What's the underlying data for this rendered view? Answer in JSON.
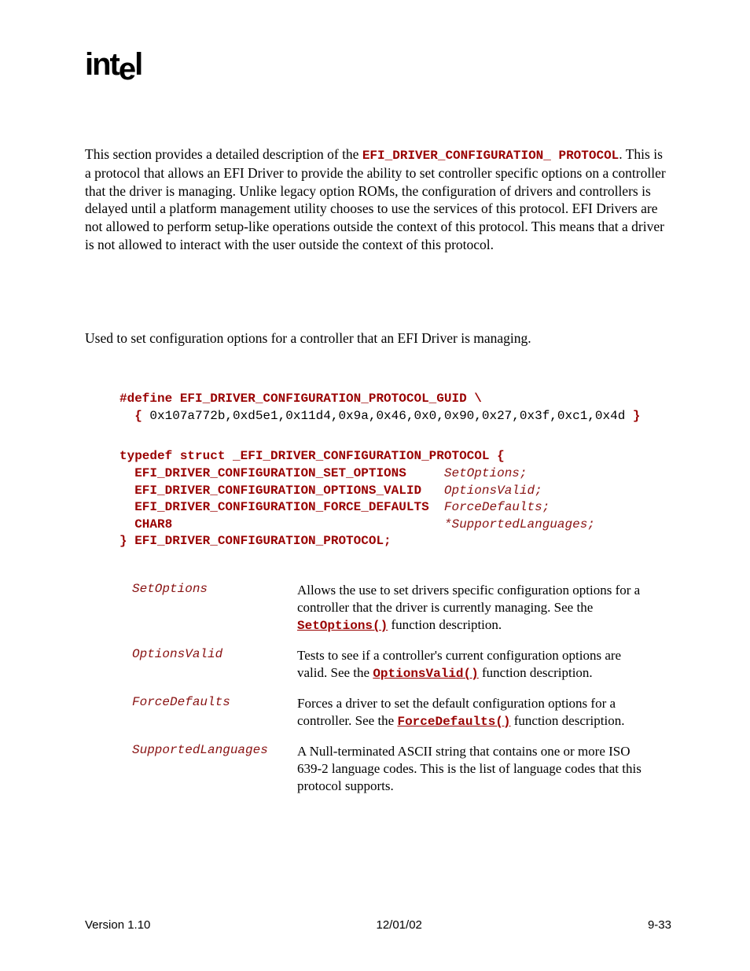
{
  "intro": {
    "pre1": "This section provides a detailed description of the ",
    "code1": "EFI_DRIVER_CONFIGURATION_ PROTOCOL",
    "post1": ".  This is a protocol that allows an EFI Driver to provide the ability to set controller specific options on a controller that the driver is managing.  Unlike legacy option ROMs, the configuration of drivers and controllers is delayed until a platform management utility chooses to use the services of this protocol.  EFI Drivers are not allowed to perform setup-like operations outside the context of this protocol.  This means that a driver is not allowed to interact with the user outside the context of this protocol."
  },
  "summary": "Used to set configuration options for a controller that an EFI Driver is managing.",
  "guid": {
    "line1": "#define EFI_DRIVER_CONFIGURATION_PROTOCOL_GUID \\",
    "brace_open": "  { ",
    "body": "0x107a772b,0xd5e1,0x11d4,0x9a,0x46,0x0,0x90,0x27,0x3f,0xc1,0x4d",
    "brace_close": " }"
  },
  "struct": {
    "open": "typedef struct _EFI_DRIVER_CONFIGURATION_PROTOCOL {",
    "f1_type": "  EFI_DRIVER_CONFIGURATION_SET_OPTIONS     ",
    "f1_name": "SetOptions;",
    "f2_type": "  EFI_DRIVER_CONFIGURATION_OPTIONS_VALID   ",
    "f2_name": "OptionsValid;",
    "f3_type": "  EFI_DRIVER_CONFIGURATION_FORCE_DEFAULTS  ",
    "f3_name": "ForceDefaults;",
    "f4_type": "  CHAR8                                    ",
    "f4_name": "*SupportedLanguages;",
    "close": "} EFI_DRIVER_CONFIGURATION_PROTOCOL;"
  },
  "params": {
    "p1_name": "SetOptions",
    "p1_pre": "Allows the use to set drivers specific configuration options for a controller that the driver is currently managing.  See the ",
    "p1_link": "SetOptions()",
    "p1_post": " function description.",
    "p2_name": "OptionsValid",
    "p2_pre": "Tests to see if a controller's current configuration options are valid.  See the ",
    "p2_link": "OptionsValid()",
    "p2_post": " function description.",
    "p3_name": "ForceDefaults",
    "p3_pre": "Forces a driver to set the default configuration options for a controller.  See the ",
    "p3_link": "ForceDefaults()",
    "p3_post": " function description.",
    "p4_name": "SupportedLanguages",
    "p4_desc": "A Null-terminated ASCII string that contains one or more ISO 639-2 language codes.  This is the list of language codes that this protocol supports."
  },
  "footer": {
    "left": "Version 1.10",
    "center": "12/01/02",
    "right": "9-33"
  }
}
